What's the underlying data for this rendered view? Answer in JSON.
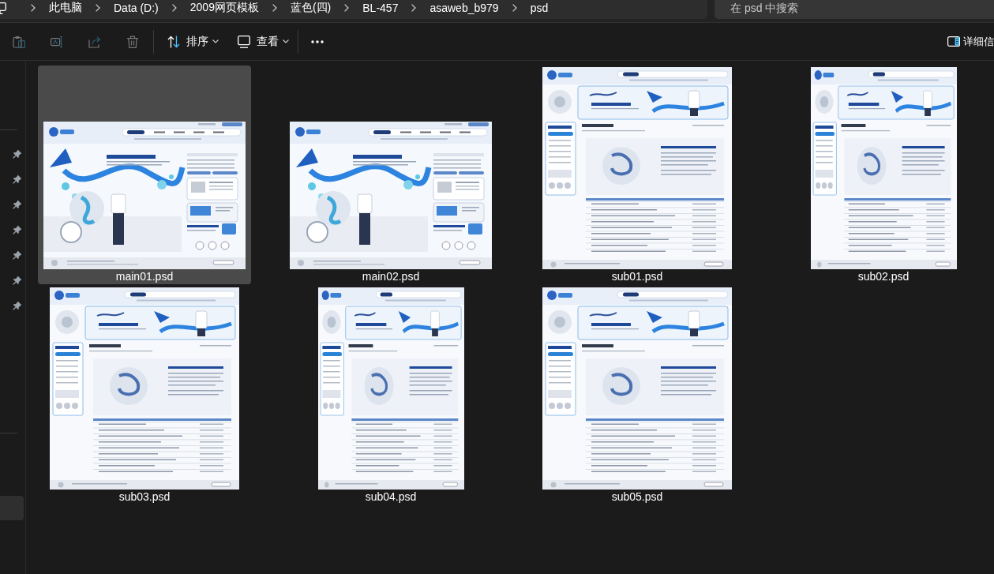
{
  "address_bar": {
    "breadcrumbs": [
      "此电脑",
      "Data (D:)",
      "2009网页模板",
      "蓝色(四)",
      "BL-457",
      "asaweb_b979",
      "psd"
    ]
  },
  "search": {
    "placeholder": "在 psd 中搜索"
  },
  "toolbar": {
    "actions": [
      {
        "kind": "paste",
        "disabled": true
      },
      {
        "kind": "rename",
        "disabled": true
      },
      {
        "kind": "share",
        "disabled": true
      },
      {
        "kind": "delete",
        "disabled": true
      }
    ],
    "menus": [
      {
        "kind": "sort",
        "label": "排序"
      },
      {
        "kind": "view",
        "label": "查看"
      }
    ],
    "details": {
      "label": "详细信"
    }
  },
  "navigation_pane": {
    "pinned_items": [
      {
        "pinned": true
      },
      {
        "pinned": true
      },
      {
        "pinned": true
      },
      {
        "pinned": true
      },
      {
        "pinned": true
      },
      {
        "pinned": true
      },
      {
        "pinned": true
      }
    ],
    "locations": [
      {
        "selected": false
      },
      {
        "selected": false
      },
      {
        "selected": true
      }
    ]
  },
  "files": [
    {
      "name": "main01.psd",
      "kind": "wide",
      "selected": true
    },
    {
      "name": "main02.psd",
      "kind": "wide",
      "selected": false
    },
    {
      "name": "sub01.psd",
      "kind": "tall",
      "selected": false
    },
    {
      "name": "sub02.psd",
      "kind": "narrow",
      "selected": false
    },
    {
      "name": "sub03.psd",
      "kind": "tall",
      "selected": false
    },
    {
      "name": "sub04.psd",
      "kind": "narrow",
      "selected": false
    },
    {
      "name": "sub05.psd",
      "kind": "tall",
      "selected": false
    }
  ]
}
